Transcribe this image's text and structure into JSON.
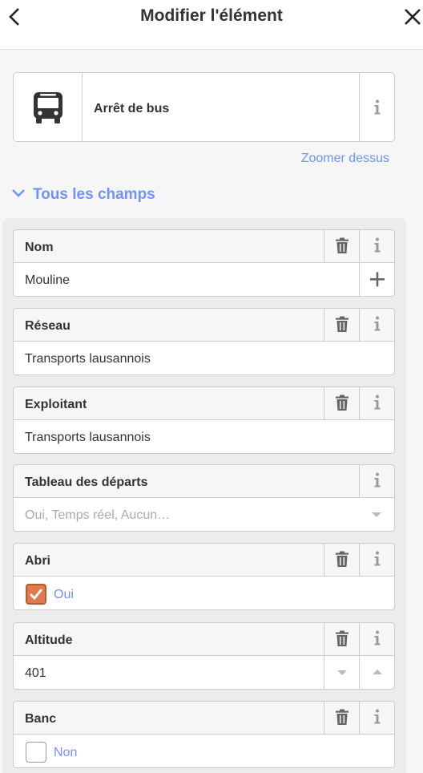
{
  "header": {
    "title": "Modifier l'élément"
  },
  "preset": {
    "name": "Arrêt de bus",
    "icon": "bus-icon"
  },
  "zoom_link": "Zoomer dessus",
  "section": {
    "label": "Tous les champs"
  },
  "fields": {
    "nom": {
      "label": "Nom",
      "value": "Mouline"
    },
    "reseau": {
      "label": "Réseau",
      "value": "Transports lausannois"
    },
    "exploitant": {
      "label": "Exploitant",
      "value": "Transports lausannois"
    },
    "departs": {
      "label": "Tableau des départs",
      "placeholder": "Oui, Temps réel, Aucun…"
    },
    "abri": {
      "label": "Abri",
      "value": "Oui",
      "checked": true
    },
    "altitude": {
      "label": "Altitude",
      "value": "401"
    },
    "banc": {
      "label": "Banc",
      "value": "Non",
      "checked": false
    }
  },
  "colors": {
    "accent": "#7092ff",
    "checked": "#e07a4d",
    "border": "#cccccc"
  }
}
